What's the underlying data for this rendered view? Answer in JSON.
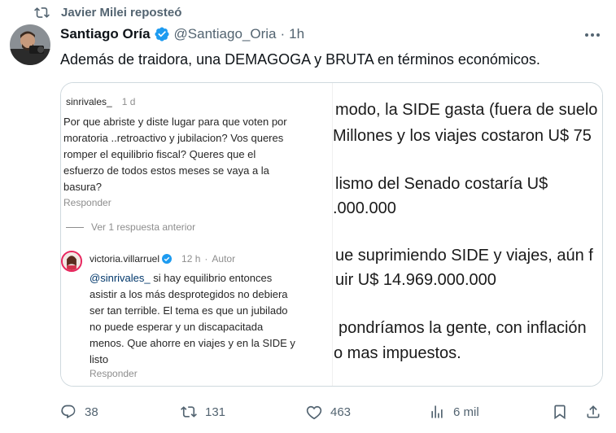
{
  "repost": {
    "label": "Javier Milei reposteó",
    "icon": "repost-icon"
  },
  "tweet": {
    "author_name": "Santiago Oría",
    "handle": "@Santiago_Oria",
    "separator": "·",
    "time": "1h",
    "text": "Además de traidora, una DEMAGOGA y BRUTA en términos económicos."
  },
  "comments": {
    "first": {
      "user": "sinrivales_",
      "age": "1 d",
      "lines": [
        "Por que abriste  y diste lugar para que voten por",
        "moratoria ..retroactivo y jubilacion? Vos queres",
        "romper el equilibrio fiscal? Queres que el",
        "esfuerzo de todos estos meses se vaya a la",
        "basura?"
      ],
      "reply_label": "Responder"
    },
    "view_replies": "Ver 1 respuesta anterior",
    "second": {
      "user": "victoria.villarruel",
      "age": "12 h",
      "separator": "·",
      "role": "Autor",
      "mention": "@sinrivales_",
      "lines": [
        " si hay equilibrio entonces",
        "asistir a los más desprotegidos no debiera",
        "ser tan terrible. El tema es que un jubilado",
        "no puede esperar y un discapacitada",
        "menos. Que ahorre en viajes y en la SIDE y",
        "listo"
      ],
      "reply_label": "Responder"
    }
  },
  "article_lines": [
    "modo, la SIDE gasta (fuera de suelo",
    "Millones y los viajes costaron U$ 75",
    "lismo del Senado costaría U$",
    ".000.000",
    "ue suprimiendo SIDE y viajes, aún f",
    "uir U$ 14.969.000.000",
    "pondríamos la gente, con inflación",
    "o mas impuestos."
  ],
  "actions": {
    "replies": "38",
    "reposts": "131",
    "likes": "463",
    "views": "6 mil"
  },
  "colors": {
    "secondary_text": "#536471",
    "verified_blue": "#1d9bf0",
    "ig_mention": "#00376b"
  }
}
